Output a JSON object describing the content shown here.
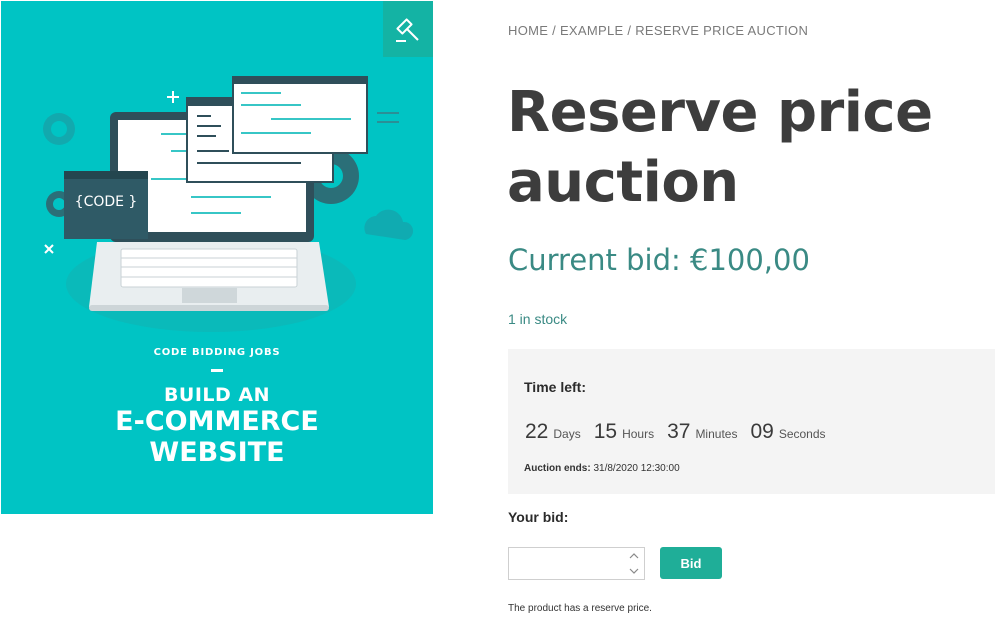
{
  "product_image": {
    "code_tag": "{CODE }",
    "kicker": "CODE BIDDING JOBS",
    "line1": "BUILD AN",
    "line2a": "E-COMMERCE",
    "line2b": "WEBSITE",
    "badge_icon": "gavel-icon"
  },
  "breadcrumb": {
    "home": "HOME",
    "sep1": " / ",
    "example": "EXAMPLE",
    "sep2": " / ",
    "current": "RESERVE PRICE AUCTION"
  },
  "product": {
    "title": "Reserve price auction",
    "price_label": "Current bid: €100,00",
    "stock": "1 in stock"
  },
  "timer": {
    "label": "Time left:",
    "days_value": "22",
    "days_label": "Days",
    "hours_value": "15",
    "hours_label": "Hours",
    "minutes_value": "37",
    "minutes_label": "Minutes",
    "seconds_value": "09",
    "seconds_label": "Seconds",
    "ends_label": "Auction ends:",
    "ends_value": " 31/8/2020 12:30:00"
  },
  "bid_form": {
    "label": "Your bid:",
    "input_value": "",
    "button_label": "Bid",
    "reserve_note": "The product has a reserve price."
  },
  "colors": {
    "image_bg": "#00c4c4",
    "accent": "#1fae98",
    "price_text": "#3a8a84"
  }
}
